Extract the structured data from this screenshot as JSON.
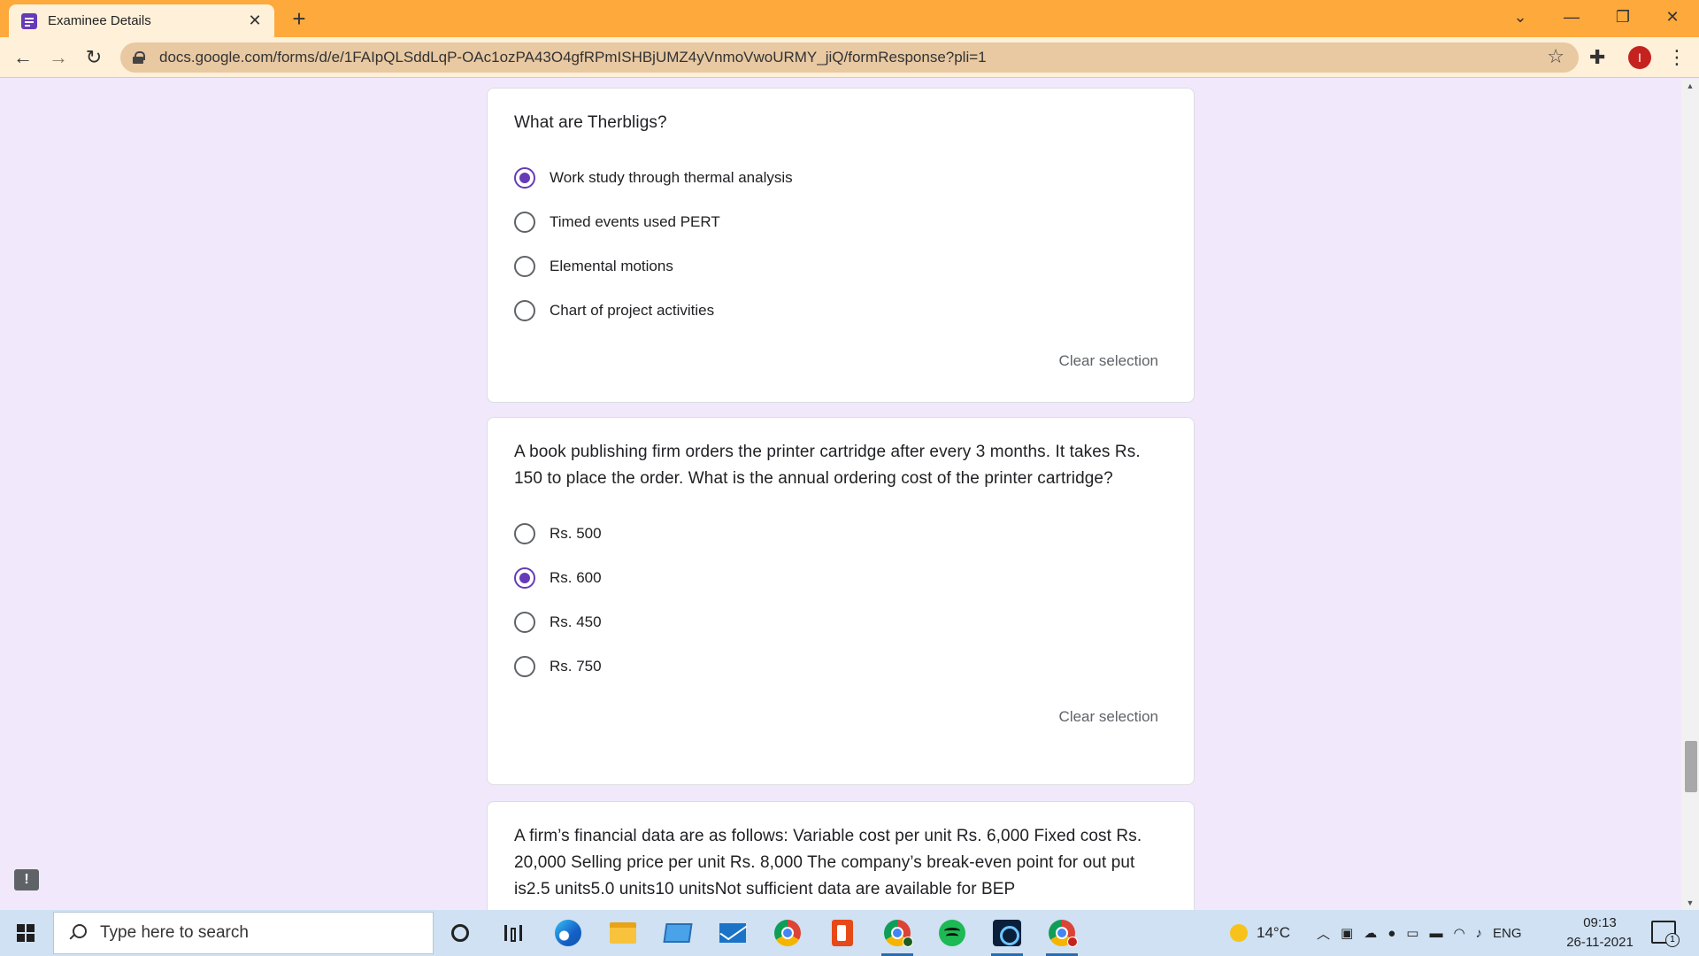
{
  "browser": {
    "tab_title": "Examinee Details",
    "tab_close": "✕",
    "new_tab": "+",
    "url": "docs.google.com/forms/d/e/1FAIpQLSddLqP-OAc1ozPA43O4gfRPmISHBjUMZ4yVnmoVwoURMY_jiQ/formResponse?pli=1",
    "profile_initial": "I",
    "accent_color": "#fea93b"
  },
  "form": {
    "accent_color": "#673ab7",
    "questions": [
      {
        "title": "What are Therbligs?",
        "options": [
          {
            "label": "Work study through thermal analysis",
            "selected": true
          },
          {
            "label": "Timed events used PERT",
            "selected": false
          },
          {
            "label": "Elemental motions",
            "selected": false
          },
          {
            "label": "Chart of project activities",
            "selected": false
          }
        ],
        "clear_label": "Clear selection"
      },
      {
        "title": "A book publishing firm orders the printer cartridge after every 3 months. It takes Rs. 150 to place the order. What is the annual ordering cost of the printer cartridge?",
        "options": [
          {
            "label": "Rs. 500",
            "selected": false
          },
          {
            "label": "Rs. 600",
            "selected": true
          },
          {
            "label": "Rs. 450",
            "selected": false
          },
          {
            "label": "Rs. 750",
            "selected": false
          }
        ],
        "clear_label": "Clear selection"
      },
      {
        "title": "A firm’s financial data are as follows: Variable cost per unit Rs. 6,000 Fixed cost Rs. 20,000 Selling price per unit Rs. 8,000 The company’s break-even point for out put is2.5 units5.0 units10 unitsNot sufficient data are available for BEP"
      }
    ],
    "feedback_label": "!"
  },
  "taskbar": {
    "search_placeholder": "Type here to search",
    "weather": "14°C",
    "language": "ENG",
    "time": "09:13",
    "date": "26-11-2021",
    "notification_count": "1"
  }
}
